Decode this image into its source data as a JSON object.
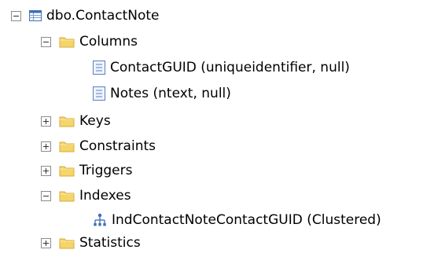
{
  "tree": {
    "table": {
      "label": "dbo.ContactNote",
      "expanded": true,
      "icon": "table-icon"
    },
    "columns_folder": {
      "label": "Columns",
      "expanded": true,
      "icon": "folder-icon"
    },
    "columns": [
      {
        "label": "ContactGUID (uniqueidentifier, null)",
        "icon": "column-icon"
      },
      {
        "label": "Notes (ntext, null)",
        "icon": "column-icon"
      }
    ],
    "keys_folder": {
      "label": "Keys",
      "expanded": false,
      "icon": "folder-icon"
    },
    "constraints_folder": {
      "label": "Constraints",
      "expanded": false,
      "icon": "folder-icon"
    },
    "triggers_folder": {
      "label": "Triggers",
      "expanded": false,
      "icon": "folder-icon"
    },
    "indexes_folder": {
      "label": "Indexes",
      "expanded": true,
      "icon": "folder-icon"
    },
    "indexes": [
      {
        "label": "IndContactNoteContactGUID (Clustered)",
        "icon": "index-icon"
      }
    ],
    "statistics_folder": {
      "label": "Statistics",
      "expanded": false,
      "icon": "folder-icon"
    }
  },
  "colors": {
    "folder_fill": "#f4d56a",
    "folder_dark": "#d9a93a",
    "table_blue": "#3f6fb3",
    "column_blue": "#5b7fc0",
    "index_blue": "#3b6cb8"
  }
}
